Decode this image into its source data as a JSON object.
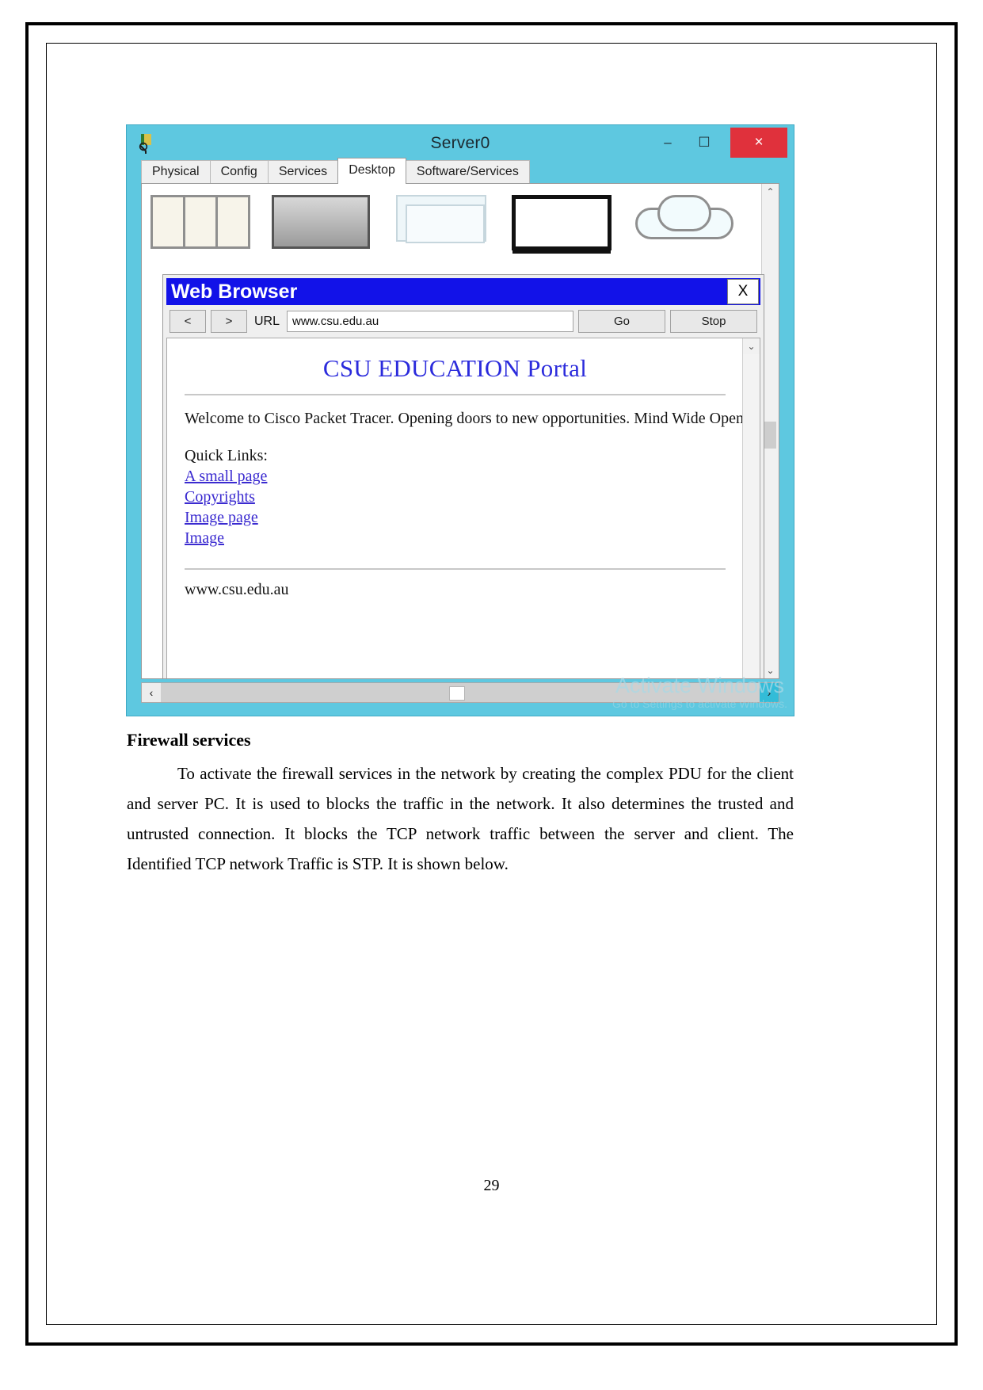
{
  "document": {
    "section_heading": "Firewall services",
    "paragraph": "To activate the firewall services in the network by creating the complex PDU for the client and server PC. It is used to blocks the traffic in the network. It also determines the trusted and untrusted connection. It blocks the TCP network traffic between the server and client. The Identified TCP network Traffic is STP. It is shown below.",
    "page_number": "29"
  },
  "device_window": {
    "title": "Server0",
    "app_icon": "packet-tracer-icon",
    "controls": {
      "minimize": "–",
      "maximize": "☐",
      "close": "×"
    },
    "tabs": [
      {
        "label": "Physical",
        "active": false
      },
      {
        "label": "Config",
        "active": false
      },
      {
        "label": "Services",
        "active": false
      },
      {
        "label": "Desktop",
        "active": true
      },
      {
        "label": "Software/Services",
        "active": false
      }
    ],
    "scroll_arrows": {
      "up": "⌃",
      "down": "⌄",
      "left": "‹",
      "right": "›"
    },
    "watermark": {
      "line1": "Activate Windows",
      "line2": "Go to Settings to activate Windows."
    }
  },
  "web_browser": {
    "title": "Web Browser",
    "close_label": "X",
    "toolbar": {
      "back_label": "<",
      "forward_label": ">",
      "url_label": "URL",
      "url_value": "www.csu.edu.au",
      "url_placeholder": "www.csu.edu.au",
      "go_label": "Go",
      "stop_label": "Stop"
    },
    "page": {
      "heading": "CSU EDUCATION Portal",
      "welcome": "Welcome to Cisco Packet Tracer. Opening doors to new opportunities. Mind Wide Open.",
      "quick_links_label": "Quick Links:",
      "links": [
        {
          "label": "A small page"
        },
        {
          "label": "Copyrights"
        },
        {
          "label": "Image page"
        },
        {
          "label": "Image"
        }
      ],
      "footer_url": "www.csu.edu.au"
    },
    "scroll_arrows": {
      "up": "⌃",
      "down": "⌄",
      "left": "‹",
      "right": "›"
    }
  },
  "colors": {
    "device_window_chrome": "#5ec8e0",
    "browser_titlebar": "#1212e8",
    "close_button": "#e0313c",
    "portal_heading": "#2b2bdc",
    "link": "#3a2ad0"
  }
}
